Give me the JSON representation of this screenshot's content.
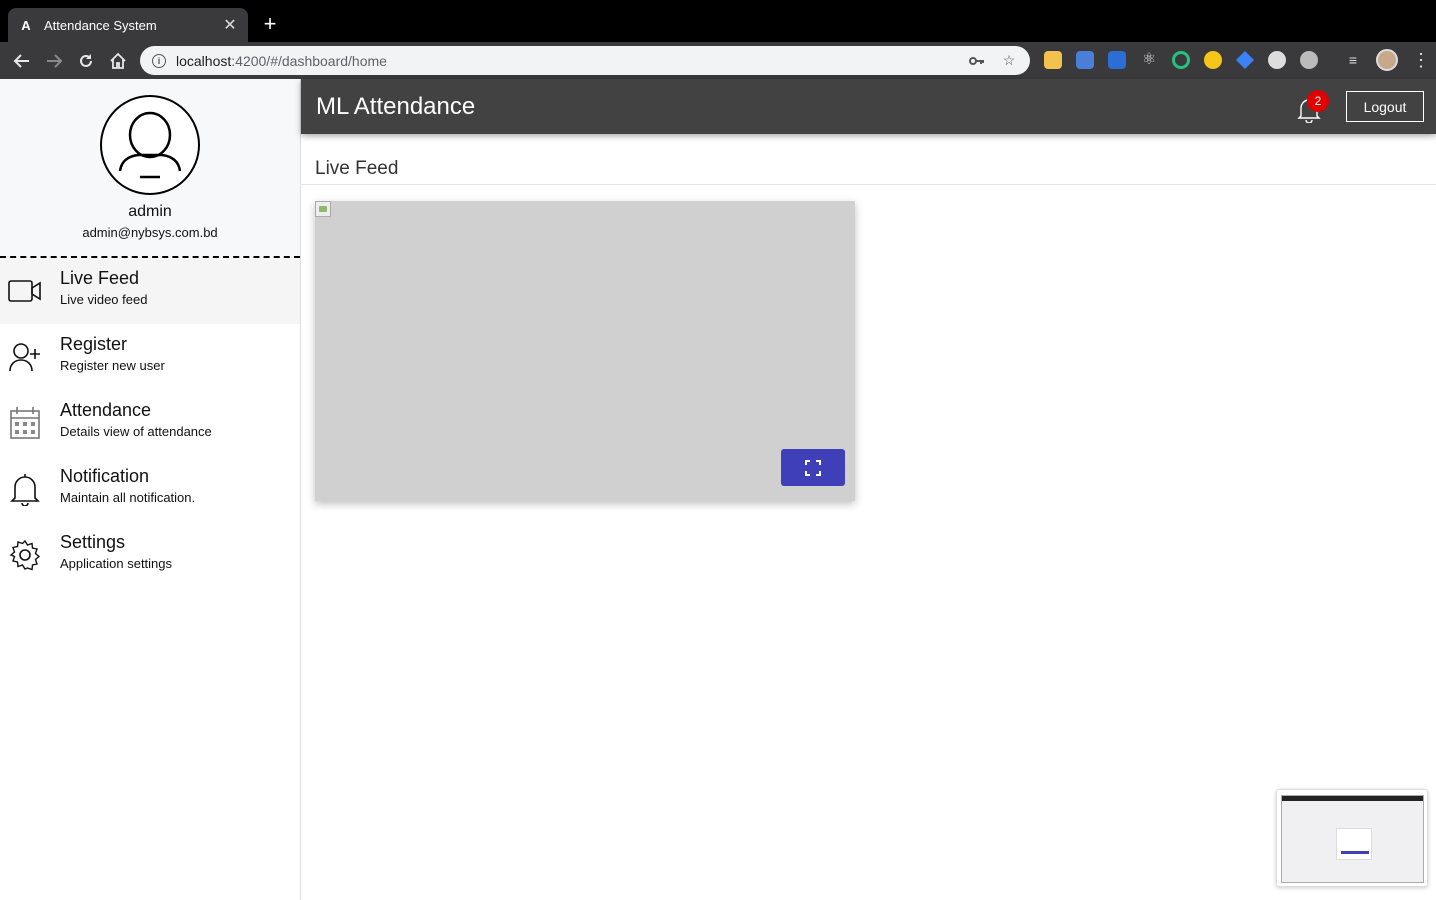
{
  "browser": {
    "tab_title": "Attendance System",
    "tab_favicon": "A",
    "url_host": "localhost",
    "url_path": ":4200/#/dashboard/home"
  },
  "sidebar": {
    "user_name": "admin",
    "user_email": "admin@nybsys.com.bd",
    "items": [
      {
        "label": "Live Feed",
        "sub": "Live video feed",
        "icon": "video-camera-icon",
        "active": true
      },
      {
        "label": "Register",
        "sub": "Register new user",
        "icon": "add-user-icon",
        "active": false
      },
      {
        "label": "Attendance",
        "sub": "Details view of attendance",
        "icon": "calendar-icon",
        "active": false
      },
      {
        "label": "Notification",
        "sub": "Maintain all notification.",
        "icon": "bell-icon",
        "active": false
      },
      {
        "label": "Settings",
        "sub": "Application settings",
        "icon": "gear-icon",
        "active": false
      }
    ]
  },
  "header": {
    "title": "ML Attendance",
    "notification_count": "2",
    "logout_label": "Logout"
  },
  "main": {
    "section_title": "Live Feed"
  },
  "colors": {
    "header_bg": "#424242",
    "accent": "#3f3fba",
    "badge": "#e10000"
  }
}
